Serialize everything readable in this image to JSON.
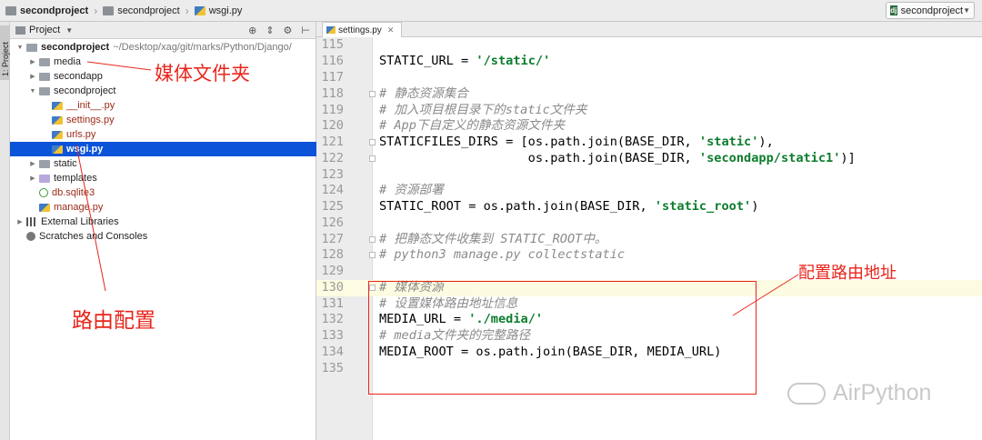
{
  "breadcrumb": {
    "items": [
      "secondproject",
      "secondproject",
      "wsgi.py"
    ]
  },
  "run_config": {
    "label": "secondproject"
  },
  "toolstrip": {
    "label": "1: Project"
  },
  "project_panel": {
    "title": "Project",
    "tree": [
      {
        "label": "secondproject",
        "extra": "~/Desktop/xag/git/marks/Python/Django/"
      },
      {
        "label": "media"
      },
      {
        "label": "secondapp"
      },
      {
        "label": "secondproject"
      },
      {
        "label": "__init__.py"
      },
      {
        "label": "settings.py"
      },
      {
        "label": "urls.py"
      },
      {
        "label": "wsgi.py"
      },
      {
        "label": "static"
      },
      {
        "label": "templates"
      },
      {
        "label": "db.sqlite3"
      },
      {
        "label": "manage.py"
      },
      {
        "label": "External Libraries"
      },
      {
        "label": "Scratches and Consoles"
      }
    ]
  },
  "annotations": {
    "media_folder": "媒体文件夹",
    "route_config": "路由配置",
    "route_address": "配置路由地址"
  },
  "editor": {
    "tab_label": "settings.py",
    "lines": [
      {
        "num": "115",
        "text": ""
      },
      {
        "num": "116",
        "text": "STATIC_URL = '/static/'"
      },
      {
        "num": "117",
        "text": ""
      },
      {
        "num": "118",
        "text": "# 静态资源集合"
      },
      {
        "num": "119",
        "text": "# 加入项目根目录下的static文件夹"
      },
      {
        "num": "120",
        "text": "# App下自定义的静态资源文件夹"
      },
      {
        "num": "121",
        "text": "STATICFILES_DIRS = [os.path.join(BASE_DIR, 'static'),"
      },
      {
        "num": "122",
        "text": "                    os.path.join(BASE_DIR, 'secondapp/static1')]"
      },
      {
        "num": "123",
        "text": ""
      },
      {
        "num": "124",
        "text": "# 资源部署"
      },
      {
        "num": "125",
        "text": "STATIC_ROOT = os.path.join(BASE_DIR, 'static_root')"
      },
      {
        "num": "126",
        "text": ""
      },
      {
        "num": "127",
        "text": "# 把静态文件收集到 STATIC_ROOT中。"
      },
      {
        "num": "128",
        "text": "# python3 manage.py collectstatic"
      },
      {
        "num": "129",
        "text": ""
      },
      {
        "num": "130",
        "text": "# 媒体资源"
      },
      {
        "num": "131",
        "text": "# 设置媒体路由地址信息"
      },
      {
        "num": "132",
        "text": "MEDIA_URL = './media/'"
      },
      {
        "num": "133",
        "text": "# media文件夹的完整路径"
      },
      {
        "num": "134",
        "text": "MEDIA_ROOT = os.path.join(BASE_DIR, MEDIA_URL)"
      },
      {
        "num": "135",
        "text": ""
      }
    ]
  },
  "watermark": {
    "text": "AirPython"
  },
  "colors": {
    "accent_red": "#e8251b",
    "selection_blue": "#0b53d8",
    "string_green": "#0c7d2d"
  }
}
